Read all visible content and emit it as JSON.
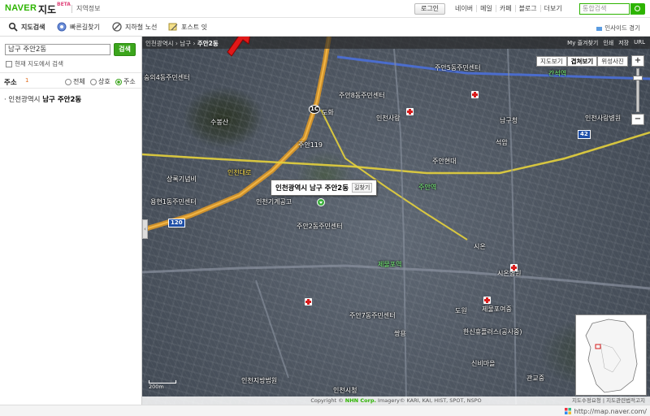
{
  "header": {
    "logo": "NAVER",
    "product": "지도",
    "beta": "BETA",
    "section": "지역정보",
    "login": "로그인",
    "nav": [
      "네이버",
      "메일",
      "카페",
      "블로그",
      "더보기"
    ],
    "search_placeholder": "통합검색"
  },
  "toolbar": {
    "items": [
      {
        "label": "지도검색",
        "icon": "magnifier-icon"
      },
      {
        "label": "빠른길찾기",
        "icon": "route-icon"
      },
      {
        "label": "지하철 노선",
        "icon": "subway-icon"
      },
      {
        "label": "포스트 잇",
        "icon": "post-it-icon"
      }
    ],
    "insight": "인사이드 경기"
  },
  "sidebar": {
    "query": "남구 주안2동",
    "search_label": "검색",
    "in_map_label": "현재 지도에서 검색",
    "filter_title": "주소",
    "filter_count": "1",
    "filters": [
      {
        "label": "전체",
        "selected": false
      },
      {
        "label": "상호",
        "selected": false
      },
      {
        "label": "주소",
        "selected": true
      }
    ],
    "result_prefix": "인천광역시",
    "result_highlight": "남구 주안2동"
  },
  "map": {
    "breadcrumb": [
      "인천광역시",
      "남구",
      "주안2동"
    ],
    "tools": [
      "My 즐겨찾기",
      "인쇄",
      "저장",
      "URL"
    ],
    "view_tabs": [
      {
        "label": "지도보기",
        "active": false
      },
      {
        "label": "겹쳐보기",
        "active": true
      },
      {
        "label": "위성사진",
        "active": false
      }
    ],
    "popup_title": "인천광역시 남구 주안2동",
    "popup_route": "길찾기",
    "labels": [
      {
        "text": "주안5동주민센터",
        "style": "white"
      },
      {
        "text": "제물포여중",
        "style": "white"
      },
      {
        "text": "시온",
        "style": "white"
      },
      {
        "text": "인천사랑",
        "style": "white"
      },
      {
        "text": "주안2동주민센터",
        "style": "white"
      },
      {
        "text": "주안현대",
        "style": "white"
      },
      {
        "text": "도화",
        "style": "white"
      },
      {
        "text": "주안119",
        "style": "white"
      },
      {
        "text": "수봉산",
        "style": "white"
      },
      {
        "text": "용현1동주민센터",
        "style": "white"
      },
      {
        "text": "인천기계공고",
        "style": "white"
      },
      {
        "text": "석암",
        "style": "white"
      },
      {
        "text": "도원",
        "style": "white"
      },
      {
        "text": "쌍용",
        "style": "white"
      },
      {
        "text": "신비마을",
        "style": "white"
      },
      {
        "text": "관교중",
        "style": "white"
      },
      {
        "text": "인천지방법원",
        "style": "white"
      },
      {
        "text": "주안7동주민센터",
        "style": "white"
      },
      {
        "text": "인천시청",
        "style": "white"
      },
      {
        "text": "숭의4동주민센터",
        "style": "white"
      },
      {
        "text": "주안8동주민센터",
        "style": "white"
      },
      {
        "text": "상록기념비",
        "style": "white"
      },
      {
        "text": "제물포역",
        "style": "green"
      },
      {
        "text": "주안역",
        "style": "green"
      },
      {
        "text": "간석역",
        "style": "green"
      },
      {
        "text": "인천사랑병원",
        "style": "white"
      },
      {
        "text": "시온병원",
        "style": "white"
      },
      {
        "text": "남구청",
        "style": "white"
      },
      {
        "text": "한신휴플러스(공사중)",
        "style": "white"
      },
      {
        "text": "인천대로",
        "style": "yellow"
      }
    ],
    "shields": [
      {
        "text": "120",
        "kind": "rect"
      },
      {
        "text": "1C",
        "kind": "round"
      },
      {
        "text": "42",
        "kind": "rect"
      }
    ],
    "scale_label": "200m"
  },
  "footer": {
    "copyright_prefix": "Copyright ©",
    "company": "NHN Corp.",
    "imagery": "Imagery© KARI, KAI, HIST, SPOT, NSPO",
    "links": "지도수정요청 | 지도관련법적고지",
    "url": "http://map.naver.com/"
  },
  "colors": {
    "brand_green": "#2db400",
    "road_orange": "#d4932a",
    "road_yellow": "#e6d13c",
    "arrow_red": "#e01818"
  }
}
